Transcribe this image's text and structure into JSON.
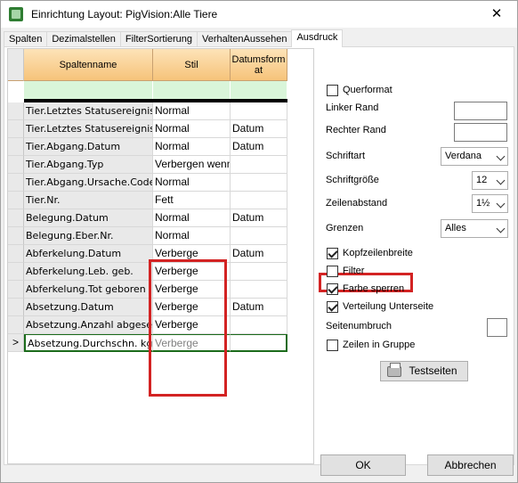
{
  "window": {
    "title": "Einrichtung Layout: PigVision:Alle Tiere",
    "close_glyph": "✕"
  },
  "tabs": [
    {
      "label": "Spalten"
    },
    {
      "label": "Dezimalstellen"
    },
    {
      "label": "FilterSortierung"
    },
    {
      "label": "VerhaltenAussehen"
    },
    {
      "label": "Ausdruck"
    }
  ],
  "grid": {
    "headers": {
      "col1": "Spaltenname",
      "col2": "Stil",
      "col3": "Datumsform at"
    },
    "current_row_marker": ">",
    "rows": [
      {
        "name": "Tier.Letztes Statusereignis.T",
        "stil": "Normal",
        "datum": ""
      },
      {
        "name": "Tier.Letztes Statusereignis.D",
        "stil": "Normal",
        "datum": "Datum"
      },
      {
        "name": "Tier.Abgang.Datum",
        "stil": "Normal",
        "datum": "Datum"
      },
      {
        "name": "Tier.Abgang.Typ",
        "stil": "Verbergen wenn",
        "datum": ""
      },
      {
        "name": "Tier.Abgang.Ursache.Code",
        "stil": "Normal",
        "datum": ""
      },
      {
        "name": "Tier.Nr.",
        "stil": "Fett",
        "datum": ""
      },
      {
        "name": "Belegung.Datum",
        "stil": "Normal",
        "datum": "Datum"
      },
      {
        "name": "Belegung.Eber.Nr.",
        "stil": "Normal",
        "datum": ""
      },
      {
        "name": "Abferkelung.Datum",
        "stil": "Verberge",
        "datum": "Datum"
      },
      {
        "name": "Abferkelung.Leb. geb.",
        "stil": "Verberge",
        "datum": ""
      },
      {
        "name": "Abferkelung.Tot geboren",
        "stil": "Verberge",
        "datum": ""
      },
      {
        "name": "Absetzung.Datum",
        "stil": "Verberge",
        "datum": "Datum"
      },
      {
        "name": "Absetzung.Anzahl abgesetzt",
        "stil": "Verberge",
        "datum": ""
      },
      {
        "name": "Absetzung.Durchschn. kg",
        "stil": "Verberge",
        "datum": ""
      }
    ]
  },
  "settings": {
    "querformat": {
      "label": "Querformat",
      "checked": false
    },
    "linker_rand": {
      "label": "Linker Rand",
      "value": ""
    },
    "rechter_rand": {
      "label": "Rechter Rand",
      "value": ""
    },
    "schriftart": {
      "label": "Schriftart",
      "value": "Verdana"
    },
    "schriftgroesse": {
      "label": "Schriftgröße",
      "value": "12"
    },
    "zeilenabstand": {
      "label": "Zeilenabstand",
      "value": "1½"
    },
    "grenzen": {
      "label": "Grenzen",
      "value": "Alles"
    },
    "kopfzeilenbreite": {
      "label": "Kopfzeilenbreite",
      "checked": true
    },
    "filter": {
      "label": "Filter",
      "checked": false
    },
    "farbe_sperren": {
      "label": "Farbe sperren",
      "checked": true
    },
    "verteilung_unterseite": {
      "label": "Verteilung Unterseite",
      "checked": true
    },
    "seitenumbruch": {
      "label": "Seitenumbruch",
      "value": ""
    },
    "zeilen_in_gruppe": {
      "label": "Zeilen in Gruppe",
      "checked": false
    },
    "testseiten_label": "Testseiten"
  },
  "footer": {
    "ok_label": "OK",
    "cancel_label": "Abbrechen"
  },
  "highlight_color": "#d32323"
}
